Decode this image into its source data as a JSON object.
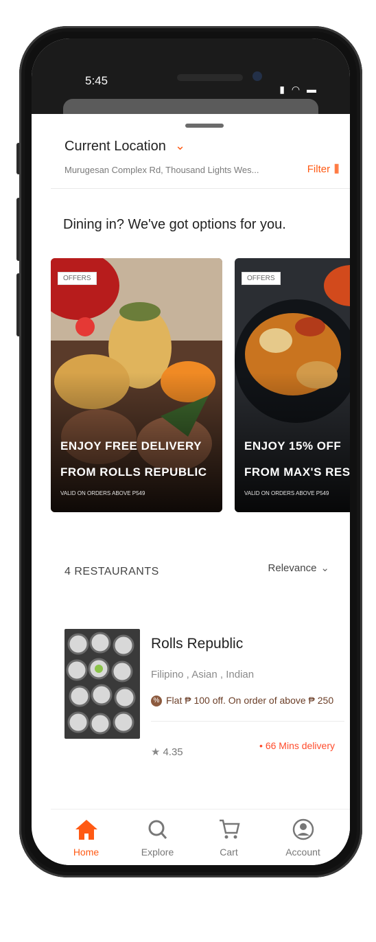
{
  "status": {
    "time": "5:45"
  },
  "location": {
    "title": "Current Location",
    "address": "Murugesan Complex Rd, Thousand Lights Wes...",
    "filter_label": "Filter"
  },
  "dining_title": "Dining in? We've got options for you.",
  "offers": [
    {
      "tag": "OFFERS",
      "line1": "ENJOY FREE DELIVERY",
      "line2": "FROM ROLLS REPUBLIC",
      "note": "VALID ON ORDERS ABOVE P549"
    },
    {
      "tag": "OFFERS",
      "line1": "ENJOY 15% OFF",
      "line2": "FROM MAX'S RESTAUR",
      "note": "VALID ON ORDERS ABOVE P549"
    }
  ],
  "list": {
    "count": "4 RESTAURANTS",
    "sort_label": "Relevance"
  },
  "restaurant": {
    "name": "Rolls Republic",
    "cuisine": "Filipino , Asian , Indian",
    "offer": "Flat ₱ 100 off. On order of above ₱ 250",
    "rating": "4.35",
    "delivery": "• 66 Mins delivery"
  },
  "tabs": [
    {
      "label": "Home",
      "icon": "home-icon",
      "active": true
    },
    {
      "label": "Explore",
      "icon": "search-icon",
      "active": false
    },
    {
      "label": "Cart",
      "icon": "cart-icon",
      "active": false
    },
    {
      "label": "Account",
      "icon": "account-icon",
      "active": false
    }
  ],
  "colors": {
    "accent": "#ff5a14",
    "delivery": "#ff4b2b",
    "text": "#222222"
  }
}
